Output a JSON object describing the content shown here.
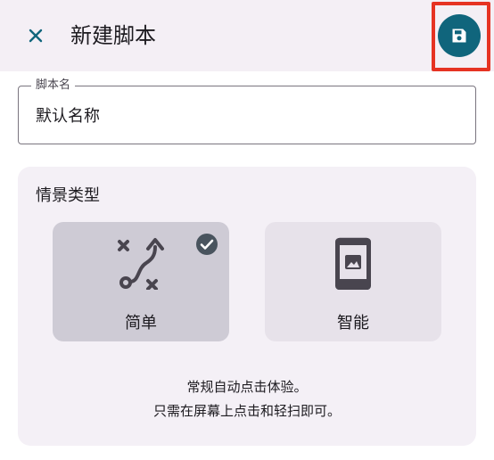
{
  "appbar": {
    "title": "新建脚本",
    "close_icon": "close-icon",
    "save_icon": "floppy-disk-icon"
  },
  "name_field": {
    "label": "脚本名",
    "value": "默认名称"
  },
  "scene_type": {
    "title": "情景类型",
    "options": [
      {
        "label": "简单",
        "icon": "route-icon",
        "selected": true
      },
      {
        "label": "智能",
        "icon": "phone-image-icon",
        "selected": false
      }
    ],
    "description_line1": "常规自动点击体验。",
    "description_line2": "只需在屏幕上点击和轻扫即可。"
  },
  "colors": {
    "accent": "#10657c",
    "highlight_border": "#e63323",
    "appbar_bg": "#f4eff5",
    "selected_option_bg": "#cecbd5",
    "option_bg": "#e7e2ea"
  }
}
